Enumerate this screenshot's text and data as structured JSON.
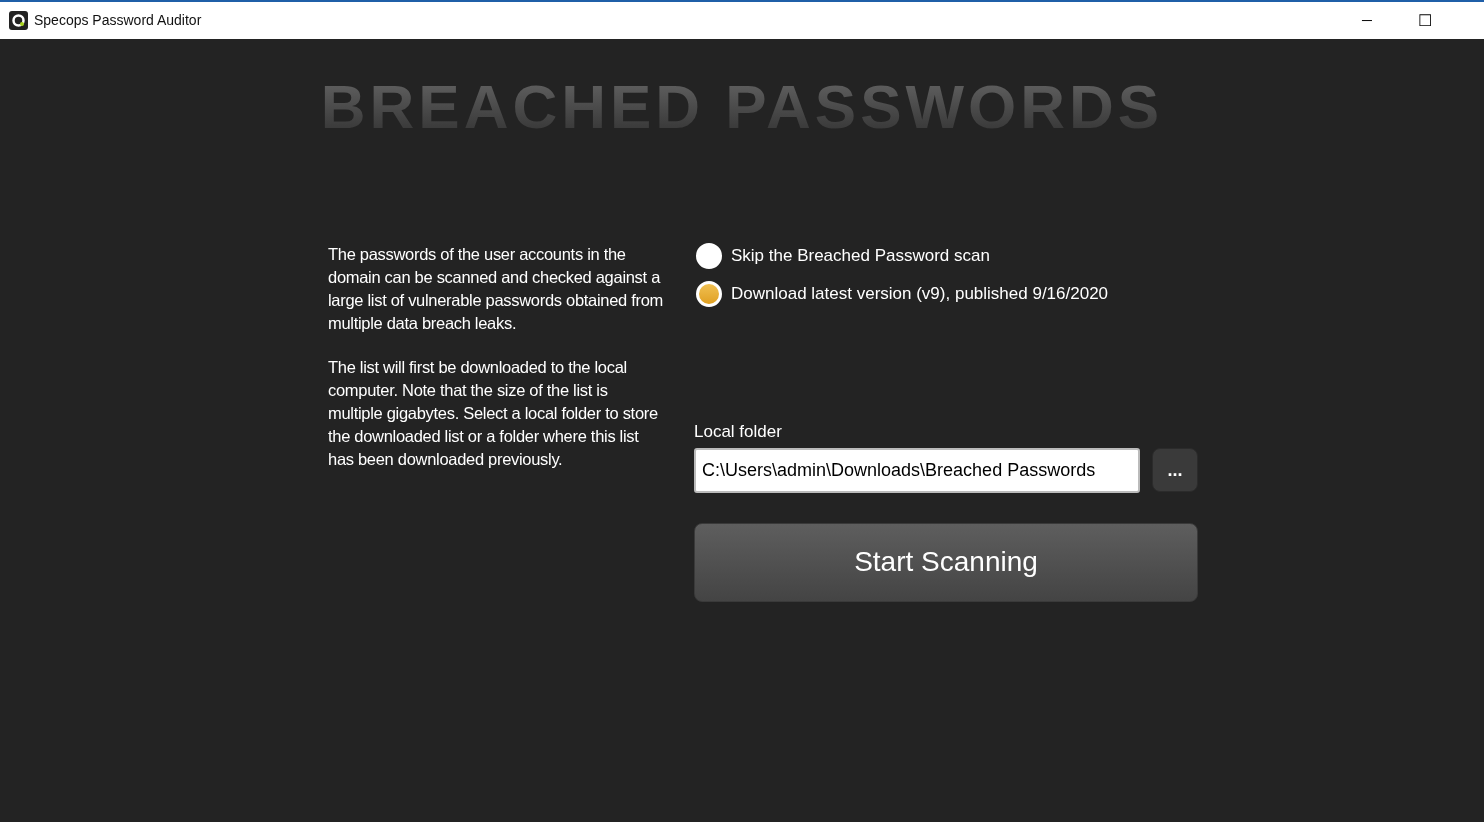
{
  "window": {
    "title": "Specops Password Auditor",
    "controls": [
      "─",
      "☐"
    ]
  },
  "heading": "BREACHED PASSWORDS",
  "description": [
    "The passwords of the user accounts in the domain can be scanned and checked against a large list of vulnerable passwords obtained from multiple data breach leaks.",
    "The list will first be downloaded to the local computer. Note that the size of the list is multiple gigabytes. Select a local folder to store the downloaded list or a folder where this list has been downloaded previously."
  ],
  "options": [
    {
      "label": "Skip the Breached Password scan",
      "selected": false
    },
    {
      "label": "Download latest version (v9), published 9/16/2020",
      "selected": true
    }
  ],
  "local_folder": {
    "label": "Local folder",
    "value": "C:\\Users\\admin\\Downloads\\Breached Passwords",
    "browse": "..."
  },
  "start_button": "Start Scanning"
}
